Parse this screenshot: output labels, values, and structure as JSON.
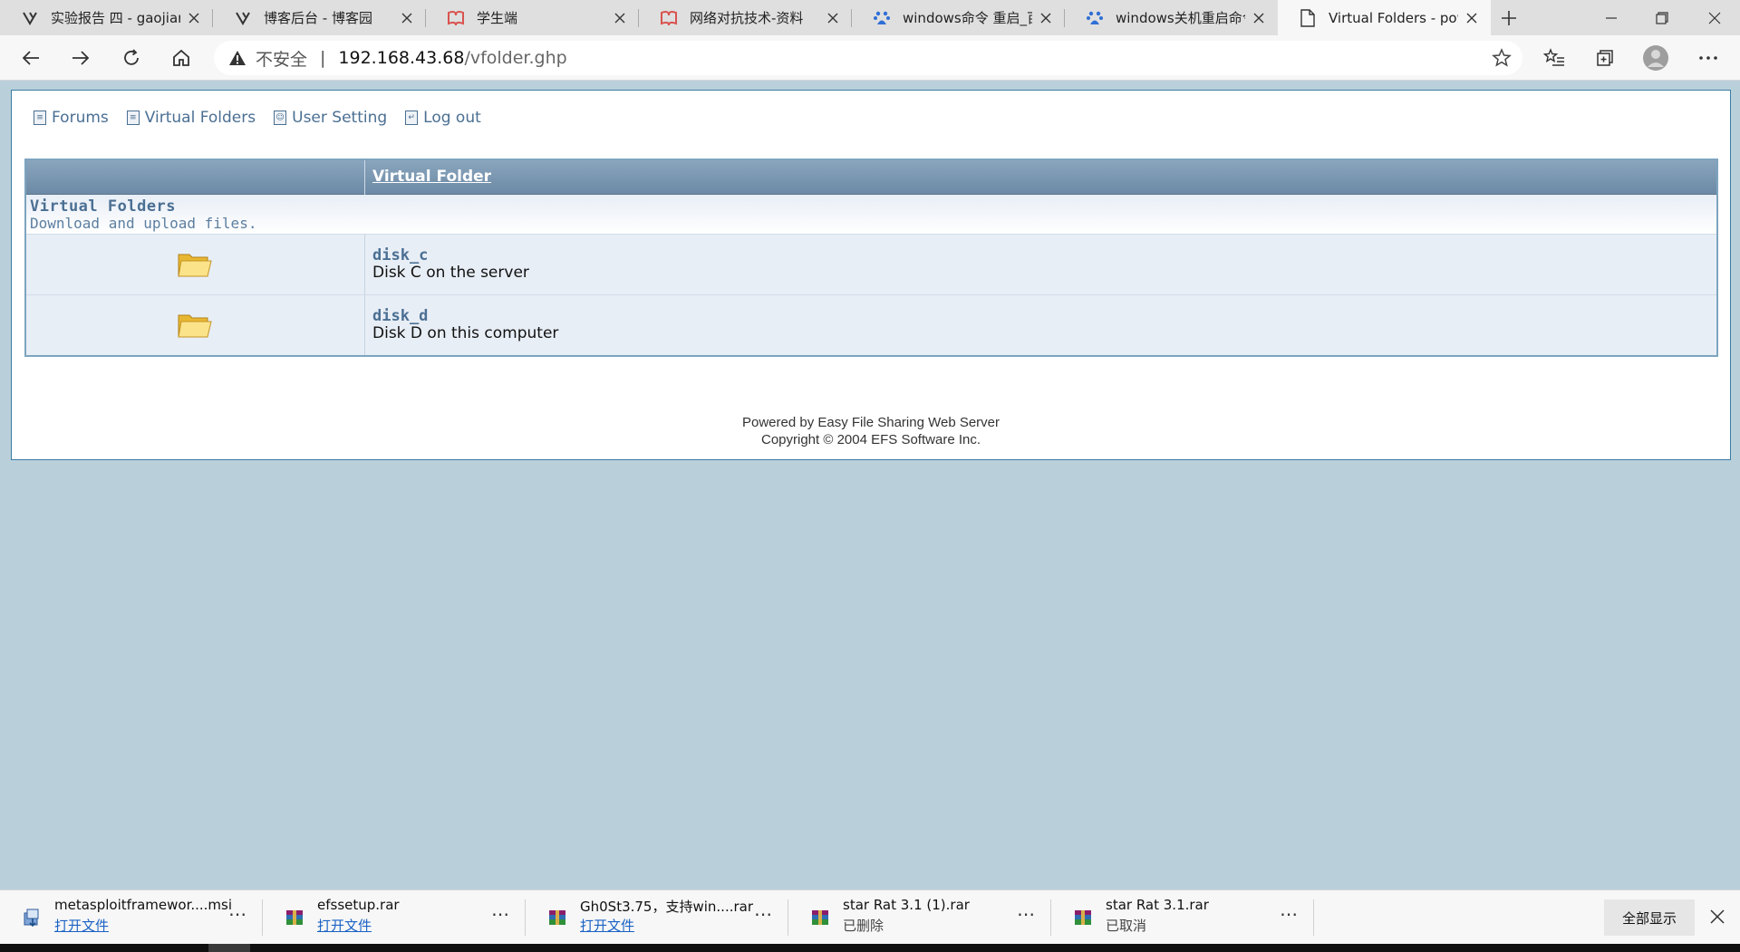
{
  "browser": {
    "tabs": [
      {
        "title": "实验报告 四 - gaojianp",
        "icon": "zhiyun-icon"
      },
      {
        "title": "博客后台 - 博客园",
        "icon": "zhiyun-icon"
      },
      {
        "title": "学生端",
        "icon": "graduation-icon"
      },
      {
        "title": "网络对抗技术-资料",
        "icon": "graduation-icon"
      },
      {
        "title": "windows命令 重启_百",
        "icon": "baidu-paw-icon"
      },
      {
        "title": "windows关机重启命令",
        "icon": "baidu-paw-icon"
      },
      {
        "title": "Virtual Folders - power",
        "icon": "page-icon",
        "active": true
      }
    ],
    "address": {
      "security_label": "不安全",
      "separator": "|",
      "host": "192.168.43.68",
      "path": "/vfolder.ghp"
    }
  },
  "page": {
    "nav": [
      {
        "label": "Forums",
        "icon": "forums-icon"
      },
      {
        "label": "Virtual Folders",
        "icon": "folders-list-icon"
      },
      {
        "label": "User Setting",
        "icon": "user-icon"
      },
      {
        "label": "Log out",
        "icon": "logout-icon"
      }
    ],
    "table": {
      "header": "Virtual Folder",
      "caption_title": "Virtual Folders",
      "caption_subtitle": "Download and upload files.",
      "rows": [
        {
          "name": "disk_c",
          "description": "Disk C on the server"
        },
        {
          "name": "disk_d",
          "description": "Disk D on this computer"
        }
      ]
    },
    "footer": {
      "line1": "Powered by Easy File Sharing Web Server",
      "line2": "Copyright © 2004 EFS Software Inc."
    }
  },
  "downloads": {
    "items": [
      {
        "name": "metasploitframewor....msi",
        "status": "打开文件",
        "status_is_link": true,
        "icon": "msi-installer-icon"
      },
      {
        "name": "efssetup.rar",
        "status": "打开文件",
        "status_is_link": true,
        "icon": "rar-archive-icon"
      },
      {
        "name": "Gh0St3.75，支持win....rar",
        "status": "打开文件",
        "status_is_link": true,
        "icon": "rar-archive-icon"
      },
      {
        "name": "star Rat 3.1 (1).rar",
        "status": "已删除",
        "status_is_link": false,
        "icon": "rar-archive-icon"
      },
      {
        "name": "star Rat 3.1.rar",
        "status": "已取消",
        "status_is_link": false,
        "icon": "rar-archive-icon"
      }
    ],
    "more_label": "⋯",
    "show_all_label": "全部显示"
  },
  "colors": {
    "page_background": "#b9d0db",
    "link_blue": "#4b6f93",
    "header_gradient_top": "#8aa5bd",
    "header_gradient_bottom": "#6c8aa6",
    "download_link": "#1a62c4"
  }
}
